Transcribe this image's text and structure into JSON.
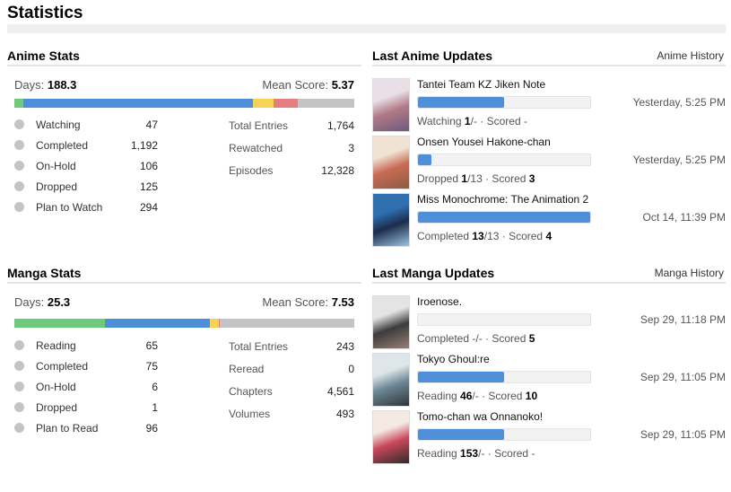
{
  "page_title": "Statistics",
  "anime_stats": {
    "title": "Anime Stats",
    "days_label": "Days:",
    "days_value": "188.3",
    "mean_label": "Mean Score:",
    "mean_value": "5.37",
    "bar_segments": [
      {
        "status": "Watching",
        "value": 47,
        "color": "#6ec97a"
      },
      {
        "status": "Completed",
        "value": 1192,
        "color": "#4f8ed9"
      },
      {
        "status": "On-Hold",
        "value": 106,
        "color": "#f6d255"
      },
      {
        "status": "Dropped",
        "value": 125,
        "color": "#e57e7e"
      },
      {
        "status": "Plan to Watch",
        "value": 294,
        "color": "#c4c4c4"
      }
    ],
    "statuses": [
      {
        "label": "Watching",
        "count": "47"
      },
      {
        "label": "Completed",
        "count": "1,192"
      },
      {
        "label": "On-Hold",
        "count": "106"
      },
      {
        "label": "Dropped",
        "count": "125"
      },
      {
        "label": "Plan to Watch",
        "count": "294"
      }
    ],
    "totals": [
      {
        "label": "Total Entries",
        "value": "1,764"
      },
      {
        "label": "Rewatched",
        "value": "3"
      },
      {
        "label": "Episodes",
        "value": "12,328"
      }
    ]
  },
  "manga_stats": {
    "title": "Manga Stats",
    "days_label": "Days:",
    "days_value": "25.3",
    "mean_label": "Mean Score:",
    "mean_value": "7.53",
    "bar_segments": [
      {
        "status": "Reading",
        "value": 65,
        "color": "#6ec97a"
      },
      {
        "status": "Completed",
        "value": 75,
        "color": "#4f8ed9"
      },
      {
        "status": "On-Hold",
        "value": 6,
        "color": "#f6d255"
      },
      {
        "status": "Dropped",
        "value": 1,
        "color": "#e57e7e"
      },
      {
        "status": "Plan to Read",
        "value": 96,
        "color": "#c4c4c4"
      }
    ],
    "statuses": [
      {
        "label": "Reading",
        "count": "65"
      },
      {
        "label": "Completed",
        "count": "75"
      },
      {
        "label": "On-Hold",
        "count": "6"
      },
      {
        "label": "Dropped",
        "count": "1"
      },
      {
        "label": "Plan to Read",
        "count": "96"
      }
    ],
    "totals": [
      {
        "label": "Total Entries",
        "value": "243"
      },
      {
        "label": "Reread",
        "value": "0"
      },
      {
        "label": "Chapters",
        "value": "4,561"
      },
      {
        "label": "Volumes",
        "value": "493"
      }
    ]
  },
  "anime_updates": {
    "title": "Last Anime Updates",
    "history_link": "Anime History",
    "items": [
      {
        "title": "Tantei Team KZ Jiken Note",
        "progress": 0.5,
        "status": "Watching",
        "count": "1",
        "total": "/-",
        "scored_label": "· Scored",
        "score": "-",
        "date": "Yesterday, 5:25 PM",
        "thumb_colors": [
          "#e9dfe6",
          "#b07a86",
          "#6d5a7c"
        ]
      },
      {
        "title": "Onsen Yousei Hakone-chan",
        "progress": 0.077,
        "status": "Dropped",
        "count": "1",
        "total": "/13",
        "scored_label": "· Scored",
        "score": "3",
        "date": "Yesterday, 5:25 PM",
        "thumb_colors": [
          "#f1e3d3",
          "#c96b55",
          "#8a5c44"
        ]
      },
      {
        "title": "Miss Monochrome: The Animation 2",
        "progress": 1.0,
        "status": "Completed",
        "count": "13",
        "total": "/13",
        "scored_label": "· Scored",
        "score": "4",
        "date": "Oct 14, 11:39 PM",
        "thumb_colors": [
          "#2f6fb0",
          "#1c2c4a",
          "#9cc4e4"
        ]
      }
    ]
  },
  "manga_updates": {
    "title": "Last Manga Updates",
    "history_link": "Manga History",
    "items": [
      {
        "title": "Iroenose.",
        "progress": 0.0,
        "status": "Completed",
        "count": "",
        "total": "-/-",
        "scored_label": "· Scored",
        "score": "5",
        "date": "Sep 29, 11:18 PM",
        "thumb_colors": [
          "#e4e4e4",
          "#3c3c3c",
          "#9a7f73"
        ]
      },
      {
        "title": "Tokyo Ghoul:re",
        "progress": 0.5,
        "status": "Reading",
        "count": "46",
        "total": "/-",
        "scored_label": "· Scored",
        "score": "10",
        "date": "Sep 29, 11:05 PM",
        "thumb_colors": [
          "#dfe6ea",
          "#6c8796",
          "#30343a"
        ]
      },
      {
        "title": "Tomo-chan wa Onnanoko!",
        "progress": 0.5,
        "status": "Reading",
        "count": "153",
        "total": "/-",
        "scored_label": "· Scored",
        "score": "-",
        "date": "Sep 29, 11:05 PM",
        "thumb_colors": [
          "#f5e9e4",
          "#c9475a",
          "#2c2c2c"
        ]
      }
    ]
  }
}
